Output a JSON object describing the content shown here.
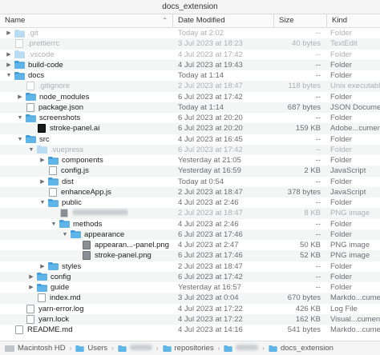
{
  "window": {
    "title": "docs_extension"
  },
  "columns": {
    "name": "Name",
    "date": "Date Modified",
    "size": "Size",
    "kind": "Kind"
  },
  "colors": {
    "folder": "#5fb4e8",
    "folder_dark": "#3f9bd9",
    "dim_folder": "#b9dcf3"
  },
  "rows": [
    {
      "depth": 0,
      "disclosure": "right",
      "icon": "folder",
      "name": ".git",
      "date": "Today at 2:02",
      "size": "--",
      "kind": "Folder",
      "dim": true
    },
    {
      "depth": 0,
      "disclosure": "none",
      "icon": "file",
      "name": ".prettierrc",
      "date": "3 Jul 2023 at 18:23",
      "size": "40 bytes",
      "kind": "TextEdit",
      "dim": true
    },
    {
      "depth": 0,
      "disclosure": "right",
      "icon": "folder",
      "name": ".vscode",
      "date": "4 Jul 2023 at 17:42",
      "size": "--",
      "kind": "Folder",
      "dim": true
    },
    {
      "depth": 0,
      "disclosure": "right",
      "icon": "folder",
      "name": "build-code",
      "date": "4 Jul 2023 at 19:43",
      "size": "--",
      "kind": "Folder",
      "dim": false
    },
    {
      "depth": 0,
      "disclosure": "down",
      "icon": "folder",
      "name": "docs",
      "date": "Today at 1:14",
      "size": "--",
      "kind": "Folder",
      "dim": false
    },
    {
      "depth": 1,
      "disclosure": "none",
      "icon": "file",
      "name": ".gitignore",
      "date": "2 Jul 2023 at 18:47",
      "size": "118 bytes",
      "kind": "Unix executable",
      "dim": true
    },
    {
      "depth": 1,
      "disclosure": "right",
      "icon": "folder",
      "name": "node_modules",
      "date": "6 Jul 2023 at 17:42",
      "size": "--",
      "kind": "Folder",
      "dim": false
    },
    {
      "depth": 1,
      "disclosure": "none",
      "icon": "file",
      "name": "package.json",
      "date": "Today at 1:14",
      "size": "687 bytes",
      "kind": "JSON Document",
      "dim": false
    },
    {
      "depth": 1,
      "disclosure": "down",
      "icon": "folder",
      "name": "screenshots",
      "date": "6 Jul 2023 at 20:20",
      "size": "--",
      "kind": "Folder",
      "dim": false
    },
    {
      "depth": 2,
      "disclosure": "none",
      "icon": "ai",
      "name": "stroke-panel.ai",
      "date": "6 Jul 2023 at 20:20",
      "size": "159 KB",
      "kind": "Adobe...cument",
      "dim": false
    },
    {
      "depth": 1,
      "disclosure": "down",
      "icon": "folder",
      "name": "src",
      "date": "4 Jul 2023 at 16:45",
      "size": "--",
      "kind": "Folder",
      "dim": false
    },
    {
      "depth": 2,
      "disclosure": "down",
      "icon": "folder",
      "name": ".vuepress",
      "date": "6 Jul 2023 at 17:42",
      "size": "--",
      "kind": "Folder",
      "dim": true
    },
    {
      "depth": 3,
      "disclosure": "right",
      "icon": "folder",
      "name": "components",
      "date": "Yesterday at 21:05",
      "size": "--",
      "kind": "Folder",
      "dim": false
    },
    {
      "depth": 3,
      "disclosure": "none",
      "icon": "file",
      "name": "config.js",
      "date": "Yesterday at 16:59",
      "size": "2 KB",
      "kind": "JavaScript",
      "dim": false
    },
    {
      "depth": 3,
      "disclosure": "right",
      "icon": "folder",
      "name": "dist",
      "date": "Today at 0:54",
      "size": "--",
      "kind": "Folder",
      "dim": false
    },
    {
      "depth": 3,
      "disclosure": "none",
      "icon": "file",
      "name": "enhanceApp.js",
      "date": "2 Jul 2023 at 18:47",
      "size": "378 bytes",
      "kind": "JavaScript",
      "dim": false
    },
    {
      "depth": 3,
      "disclosure": "down",
      "icon": "folder",
      "name": "public",
      "date": "4 Jul 2023 at 2:46",
      "size": "--",
      "kind": "Folder",
      "dim": false
    },
    {
      "depth": 4,
      "disclosure": "none",
      "icon": "img",
      "name": "",
      "date": "2 Jul 2023 at 18:47",
      "size": "8 KB",
      "kind": "PNG image",
      "dim": true,
      "blurred": true
    },
    {
      "depth": 4,
      "disclosure": "down",
      "icon": "folder",
      "name": "methods",
      "date": "4 Jul 2023 at 2:46",
      "size": "--",
      "kind": "Folder",
      "dim": false
    },
    {
      "depth": 5,
      "disclosure": "down",
      "icon": "folder",
      "name": "appearance",
      "date": "6 Jul 2023 at 17:46",
      "size": "--",
      "kind": "Folder",
      "dim": false
    },
    {
      "depth": 6,
      "disclosure": "none",
      "icon": "img",
      "name": "appearan...-panel.png",
      "date": "4 Jul 2023 at 2:47",
      "size": "50 KB",
      "kind": "PNG image",
      "dim": false
    },
    {
      "depth": 6,
      "disclosure": "none",
      "icon": "img",
      "name": "stroke-panel.png",
      "date": "6 Jul 2023 at 17:46",
      "size": "52 KB",
      "kind": "PNG image",
      "dim": false
    },
    {
      "depth": 3,
      "disclosure": "right",
      "icon": "folder",
      "name": "styles",
      "date": "2 Jul 2023 at 18:47",
      "size": "--",
      "kind": "Folder",
      "dim": false
    },
    {
      "depth": 2,
      "disclosure": "right",
      "icon": "folder",
      "name": "config",
      "date": "6 Jul 2023 at 17:42",
      "size": "--",
      "kind": "Folder",
      "dim": false
    },
    {
      "depth": 2,
      "disclosure": "right",
      "icon": "folder",
      "name": "guide",
      "date": "Yesterday at 16:57",
      "size": "--",
      "kind": "Folder",
      "dim": false
    },
    {
      "depth": 2,
      "disclosure": "none",
      "icon": "file",
      "name": "index.md",
      "date": "3 Jul 2023 at 0:04",
      "size": "670 bytes",
      "kind": "Markdo...cument",
      "dim": false
    },
    {
      "depth": 1,
      "disclosure": "none",
      "icon": "file",
      "name": "yarn-error.log",
      "date": "4 Jul 2023 at 17:22",
      "size": "426 KB",
      "kind": "Log File",
      "dim": false
    },
    {
      "depth": 1,
      "disclosure": "none",
      "icon": "file",
      "name": "yarn.lock",
      "date": "4 Jul 2023 at 17:22",
      "size": "162 KB",
      "kind": "Visual...cument",
      "dim": false
    },
    {
      "depth": 0,
      "disclosure": "none",
      "icon": "file",
      "name": "README.md",
      "date": "4 Jul 2023 at 14:16",
      "size": "541 bytes",
      "kind": "Markdo...cument",
      "dim": false
    }
  ],
  "pathbar": {
    "segments": [
      "Macintosh HD",
      "Users",
      "",
      "repositories",
      "",
      "docs_extension"
    ]
  }
}
